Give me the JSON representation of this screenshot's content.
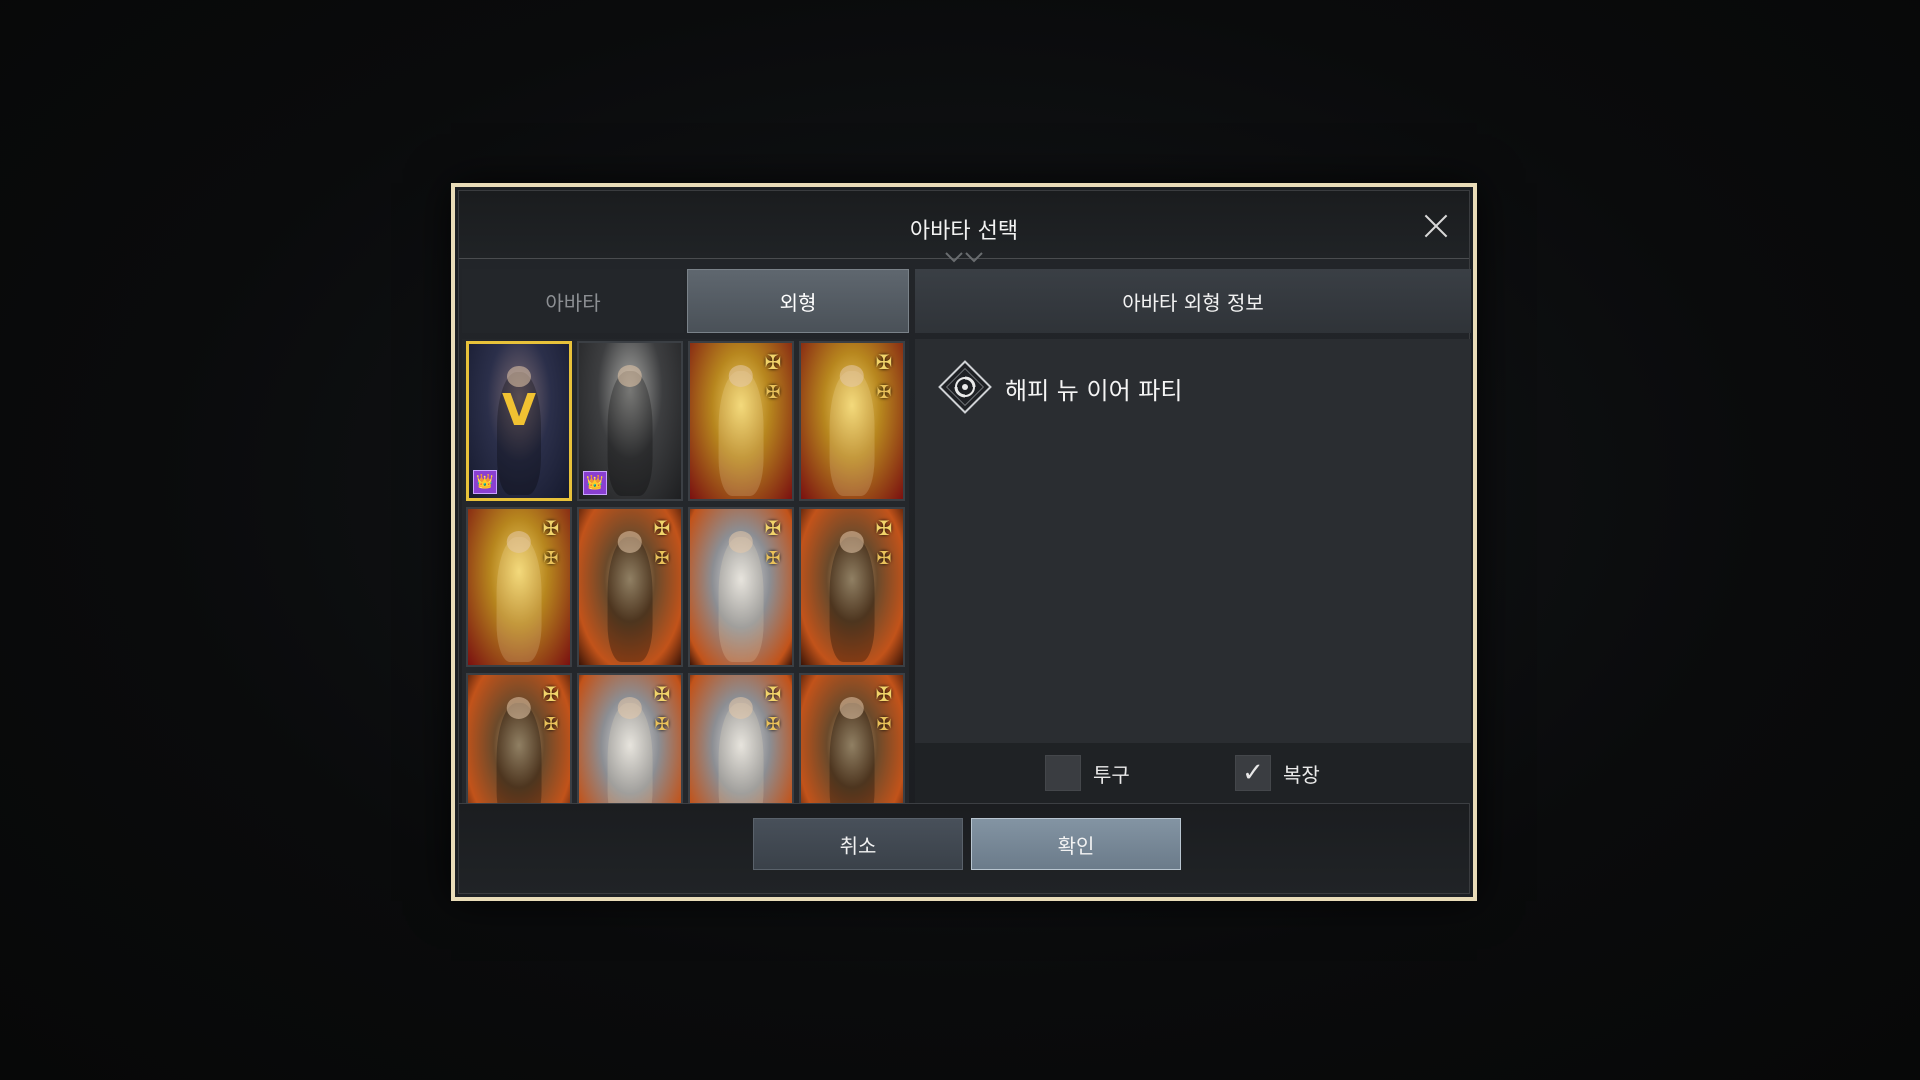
{
  "dialog": {
    "title": "아바타 선택"
  },
  "tabs": [
    {
      "label": "아바타",
      "active": false
    },
    {
      "label": "외형",
      "active": true
    }
  ],
  "info": {
    "header": "아바타 외형 정보",
    "item_name": "해피 뉴 이어 파티"
  },
  "options": {
    "helmet": {
      "label": "투구",
      "checked": false
    },
    "costume": {
      "label": "복장",
      "checked": true,
      "check_glyph": "✓"
    }
  },
  "buttons": {
    "cancel": "취소",
    "confirm": "확인"
  },
  "grid": {
    "selected_mark": "V",
    "cards": [
      {
        "art": "navy",
        "badge": "purple",
        "badge_glyph": "👑",
        "selected": true
      },
      {
        "art": "dark",
        "badge": "purple",
        "badge_glyph": "👑",
        "selected": false
      },
      {
        "art": "gold-red",
        "badge": "gold",
        "badge_glyph": "✠",
        "selected": false
      },
      {
        "art": "gold-red",
        "badge": "gold",
        "badge_glyph": "✠",
        "selected": false
      },
      {
        "art": "gold-red",
        "badge": "gold",
        "badge_glyph": "✠",
        "selected": false
      },
      {
        "art": "orange",
        "badge": "gold",
        "badge_glyph": "✠",
        "selected": false
      },
      {
        "art": "silver",
        "badge": "gold",
        "badge_glyph": "✠",
        "selected": false
      },
      {
        "art": "orange",
        "badge": "gold",
        "badge_glyph": "✠",
        "selected": false
      },
      {
        "art": "orange",
        "badge": "gold",
        "badge_glyph": "✠",
        "selected": false
      },
      {
        "art": "silver",
        "badge": "gold",
        "badge_glyph": "✠",
        "selected": false
      },
      {
        "art": "silver",
        "badge": "gold",
        "badge_glyph": "✠",
        "selected": false
      },
      {
        "art": "orange",
        "badge": "gold",
        "badge_glyph": "✠",
        "selected": false
      }
    ]
  },
  "colors": {
    "dialog_border": "#e9dcb8",
    "selected_border": "#e8c23a",
    "confirm_button": "#7a8b9a"
  }
}
